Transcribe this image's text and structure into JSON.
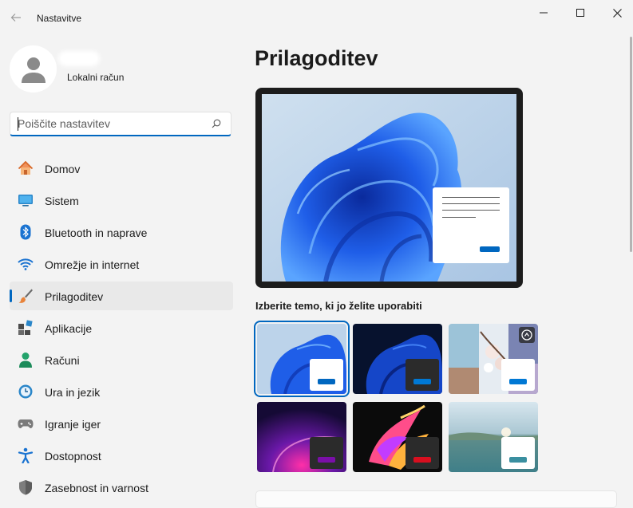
{
  "window": {
    "title": "Nastavitve",
    "controls": [
      "minimize-icon",
      "maximize-icon",
      "close-icon"
    ]
  },
  "profile": {
    "account_type": "Lokalni račun"
  },
  "search": {
    "placeholder": "Poiščite nastavitev"
  },
  "sidebar": {
    "items": [
      {
        "label": "Domov",
        "icon": "home-icon"
      },
      {
        "label": "Sistem",
        "icon": "system-icon"
      },
      {
        "label": "Bluetooth in naprave",
        "icon": "bluetooth-icon"
      },
      {
        "label": "Omrežje in internet",
        "icon": "wifi-icon"
      },
      {
        "label": "Prilagoditev",
        "icon": "paintbrush-icon",
        "selected": true
      },
      {
        "label": "Aplikacije",
        "icon": "apps-icon"
      },
      {
        "label": "Računi",
        "icon": "account-icon"
      },
      {
        "label": "Ura in jezik",
        "icon": "clock-globe-icon"
      },
      {
        "label": "Igranje iger",
        "icon": "gamepad-icon"
      },
      {
        "label": "Dostopnost",
        "icon": "accessibility-icon"
      },
      {
        "label": "Zasebnost in varnost",
        "icon": "shield-icon"
      }
    ]
  },
  "main": {
    "title": "Prilagoditev",
    "theme_heading": "Izberite temo, ki jo želite uporabiti",
    "themes": [
      {
        "name": "windows-light",
        "accent": "#0067c0",
        "selected": true
      },
      {
        "name": "windows-dark",
        "accent": "#0078d4"
      },
      {
        "name": "glow-flowers",
        "accent": "#0078d4",
        "slideshow": true
      },
      {
        "name": "captured-motion",
        "accent": "#7a0fa8"
      },
      {
        "name": "flow",
        "accent": "#d80f1f"
      },
      {
        "name": "sunrise-lake",
        "accent": "#3a8fa0"
      }
    ]
  },
  "colors": {
    "accent": "#0067c0",
    "background": "#f3f3f3"
  }
}
